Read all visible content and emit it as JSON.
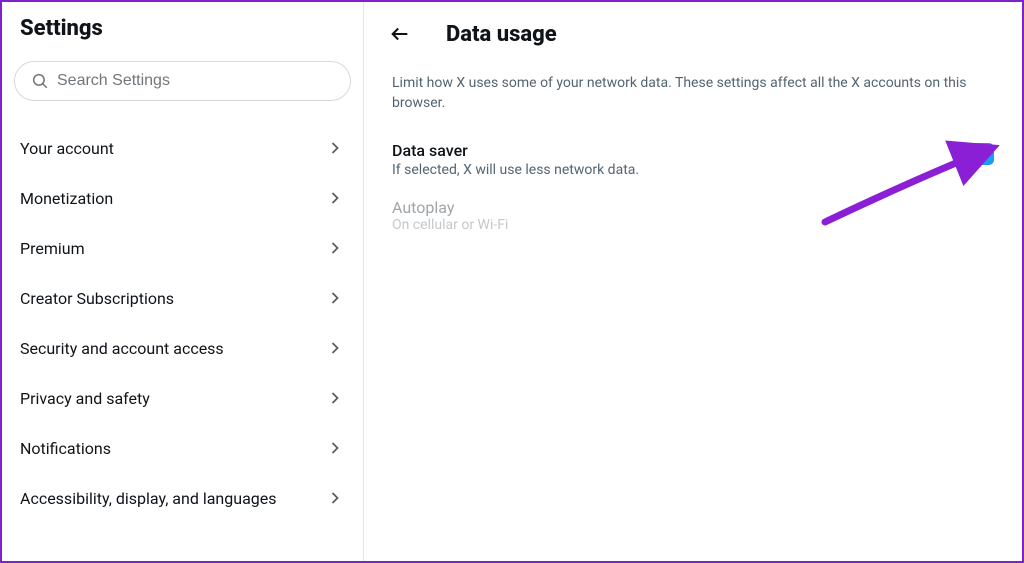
{
  "sidebar": {
    "title": "Settings",
    "search_placeholder": "Search Settings",
    "items": [
      {
        "label": "Your account"
      },
      {
        "label": "Monetization"
      },
      {
        "label": "Premium"
      },
      {
        "label": "Creator Subscriptions"
      },
      {
        "label": "Security and account access"
      },
      {
        "label": "Privacy and safety"
      },
      {
        "label": "Notifications"
      },
      {
        "label": "Accessibility, display, and languages"
      }
    ]
  },
  "main": {
    "title": "Data usage",
    "description": "Limit how X uses some of your network data. These settings affect all the X accounts on this browser.",
    "data_saver": {
      "title": "Data saver",
      "subtitle": "If selected, X will use less network data.",
      "checked": true
    },
    "autoplay": {
      "title": "Autoplay",
      "subtitle": "On cellular or Wi-Fi"
    }
  }
}
